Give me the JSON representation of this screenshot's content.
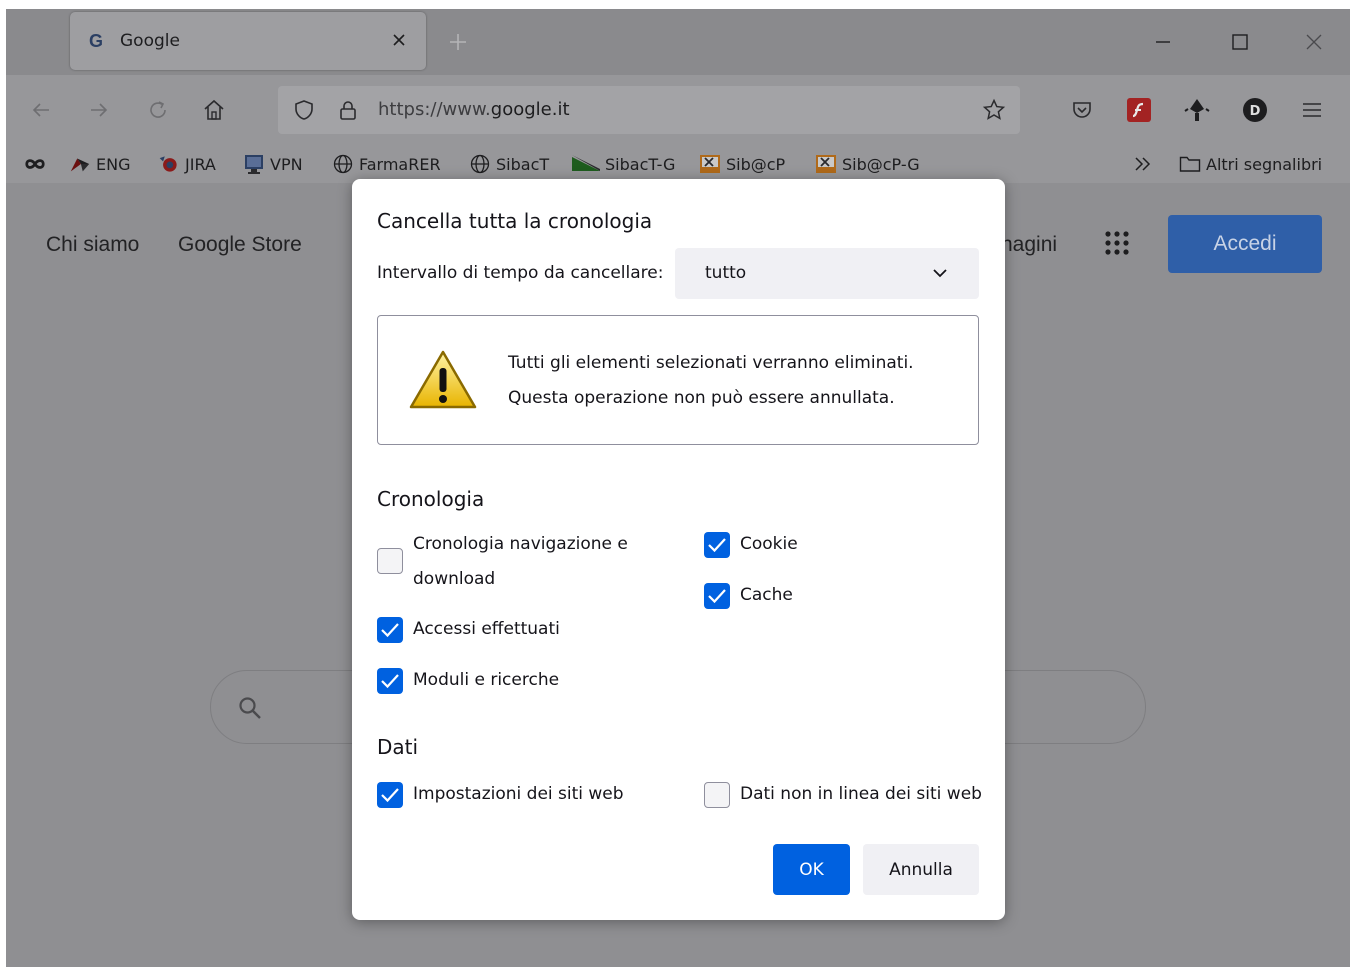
{
  "tab": {
    "title": "Google"
  },
  "urlbar": {
    "url_prefix": "https://www.",
    "url_domain": "google.it"
  },
  "bookmarks": {
    "items": [
      {
        "label": "ENG"
      },
      {
        "label": "JIRA"
      },
      {
        "label": "VPN"
      },
      {
        "label": "FarmaRER"
      },
      {
        "label": "SibacT"
      },
      {
        "label": "SibacT-G"
      },
      {
        "label": "Sib@cP"
      },
      {
        "label": "Sib@cP-G"
      }
    ],
    "other": "Altri segnalibri"
  },
  "page": {
    "link_about": "Chi siamo",
    "link_store": "Google Store",
    "link_images_partial": "nagini",
    "signin": "Accedi"
  },
  "dialog": {
    "title": "Cancella tutta la cronologia",
    "range_label": "Intervallo di tempo da cancellare:",
    "range_value": "tutto",
    "warning_line1": "Tutti gli elementi selezionati verranno eliminati.",
    "warning_line2": "Questa operazione non può essere annullata.",
    "history_heading": "Cronologia",
    "data_heading": "Dati",
    "options": {
      "browsing_history": {
        "label": "Cronologia navigazione e download",
        "checked": false
      },
      "logins": {
        "label": "Accessi effettuati",
        "checked": true
      },
      "forms": {
        "label": "Moduli e ricerche",
        "checked": true
      },
      "cookies": {
        "label": "Cookie",
        "checked": true
      },
      "cache": {
        "label": "Cache",
        "checked": true
      },
      "site_settings": {
        "label": "Impostazioni dei siti web",
        "checked": true
      },
      "offline_data": {
        "label": "Dati non in linea dei siti web",
        "checked": false
      }
    },
    "ok_label": "OK",
    "cancel_label": "Annulla"
  },
  "colors": {
    "accent": "#0061e0",
    "signin_button": "#2f5fa8",
    "dim_overlay": "#8f8f92"
  }
}
